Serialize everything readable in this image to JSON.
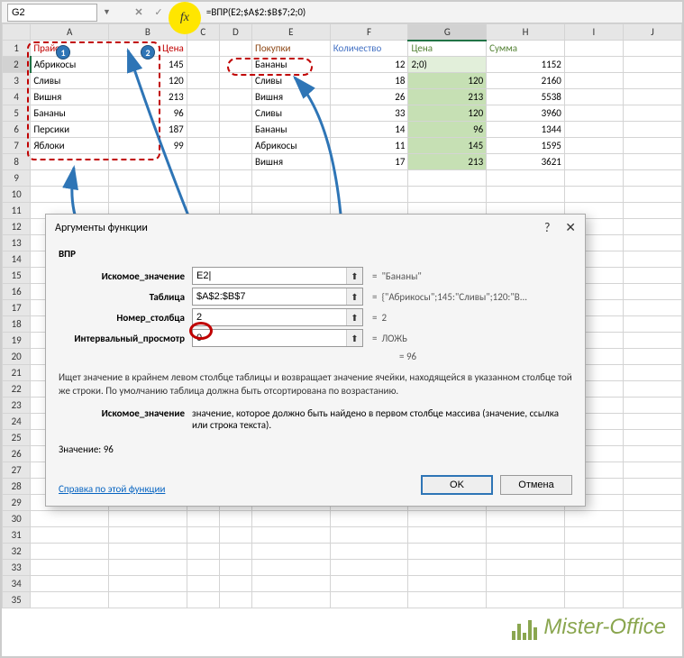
{
  "name_box": "G2",
  "formula": "=ВПР(E2;$A$2:$B$7;2;0)",
  "columns": [
    "A",
    "B",
    "C",
    "D",
    "E",
    "F",
    "G",
    "H",
    "I",
    "J"
  ],
  "rows": 35,
  "headers": {
    "a1": "Прайс",
    "b1": "Цена",
    "e1": "Покупки",
    "f1": "Количество",
    "g1": "Цена",
    "h1": "Сумма"
  },
  "price_list": [
    {
      "name": "Абрикосы",
      "price": 145
    },
    {
      "name": "Сливы",
      "price": 120
    },
    {
      "name": "Вишня",
      "price": 213
    },
    {
      "name": "Бананы",
      "price": 96
    },
    {
      "name": "Персики",
      "price": 187
    },
    {
      "name": "Яблоки",
      "price": 99
    }
  ],
  "purchases": [
    {
      "name": "Бананы",
      "qty": 12,
      "price_disp": "2;0)",
      "sum": 1152
    },
    {
      "name": "Сливы",
      "qty": 18,
      "price_disp": "120",
      "sum": 2160
    },
    {
      "name": "Вишня",
      "qty": 26,
      "price_disp": "213",
      "sum": 5538
    },
    {
      "name": "Сливы",
      "qty": 33,
      "price_disp": "120",
      "sum": 3960
    },
    {
      "name": "Бананы",
      "qty": 14,
      "price_disp": "96",
      "sum": 1344
    },
    {
      "name": "Абрикосы",
      "qty": 11,
      "price_disp": "145",
      "sum": 1595
    },
    {
      "name": "Вишня",
      "qty": 17,
      "price_disp": "213",
      "sum": 3621
    }
  ],
  "dialog": {
    "title": "Аргументы функции",
    "fn": "ВПР",
    "args": [
      {
        "label": "Искомое_значение",
        "value": "E2",
        "result": "\"Бананы\"",
        "caret": true
      },
      {
        "label": "Таблица",
        "value": "$A$2:$B$7",
        "result": "{\"Абрикосы\";145:\"Сливы\";120:\"В..."
      },
      {
        "label": "Номер_столбца",
        "value": "2",
        "result": "2"
      },
      {
        "label": "Интервальный_просмотр",
        "value": "0",
        "result": "ЛОЖЬ"
      }
    ],
    "preview_eq": "= 96",
    "description": "Ищет значение в крайнем левом столбце таблицы и возвращает значение ячейки, находящейся в указанном столбце той же строки. По умолчанию таблица должна быть отсортирована по возрастанию.",
    "arg_name": "Искомое_значение",
    "arg_desc": "значение, которое должно быть найдено в первом столбце массива (значение, ссылка или строка текста).",
    "value_label": "Значение:",
    "value": "96",
    "help_link": "Справка по этой функции",
    "ok": "OK",
    "cancel": "Отмена"
  },
  "watermark": "Mister-Office"
}
